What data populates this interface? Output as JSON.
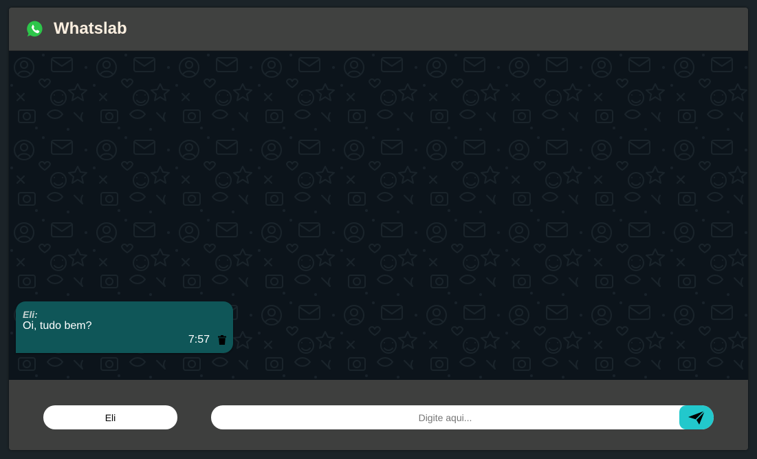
{
  "header": {
    "title": "Whatslab",
    "logo_icon": "whatsapp-logo-icon"
  },
  "theme": {
    "chat_background": "#0c141b",
    "bubble_color": "#0f5658",
    "accent": "#22c8cc",
    "title_color": "#fcefe0"
  },
  "messages": [
    {
      "author": "Eli:",
      "text": "Oi, tudo bem?",
      "time": "7:57",
      "delete_icon": "trash-icon"
    }
  ],
  "composer": {
    "name_value": "Eli",
    "message_value": "",
    "message_placeholder": "Digite aqui...",
    "send_icon": "send-icon"
  }
}
